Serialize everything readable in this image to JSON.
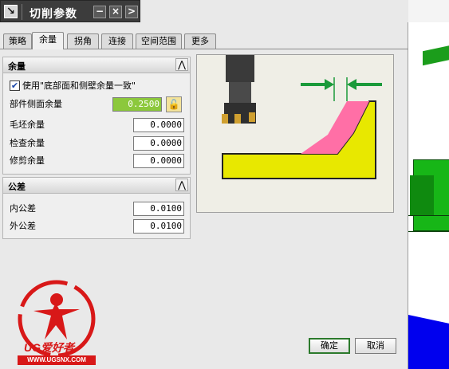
{
  "window": {
    "title": "切削参数",
    "icon": "arrow-cursor-icon",
    "buttons": [
      "−",
      "×",
      ">"
    ]
  },
  "tabs": [
    {
      "label": "策略",
      "active": false
    },
    {
      "label": "余量",
      "active": true
    },
    {
      "label": "拐角",
      "active": false
    },
    {
      "label": "连接",
      "active": false
    },
    {
      "label": "空间范围",
      "active": false
    },
    {
      "label": "更多",
      "active": false
    }
  ],
  "stock_group": {
    "title": "余量",
    "collapse": "⋀",
    "use_floor_same_as_side_label": "使用\"底部面和侧壁余量一致\"",
    "use_floor_same_as_side_checked": true,
    "part_side_stock_label": "部件侧面余量",
    "part_side_stock_value": "0.2500",
    "blank_stock_label": "毛坯余量",
    "blank_stock_value": "0.0000",
    "check_stock_label": "检查余量",
    "check_stock_value": "0.0000",
    "trim_stock_label": "修剪余量",
    "trim_stock_value": "0.0000"
  },
  "tolerance_group": {
    "title": "公差",
    "collapse": "⋀",
    "intol_label": "内公差",
    "intol_value": "0.0100",
    "outtol_label": "外公差",
    "outtol_value": "0.0100"
  },
  "buttons": {
    "ok": "确定",
    "cancel": "取消"
  },
  "watermark": {
    "brand": "UG爱好者",
    "url": "WWW.UGSNX.COM"
  },
  "colors": {
    "part": "#e8e800",
    "stock": "#ff6fa6",
    "arrows": "#1a9a3a",
    "highlight_field": "#8cc83c",
    "title_bar": "#3c3c3c"
  }
}
